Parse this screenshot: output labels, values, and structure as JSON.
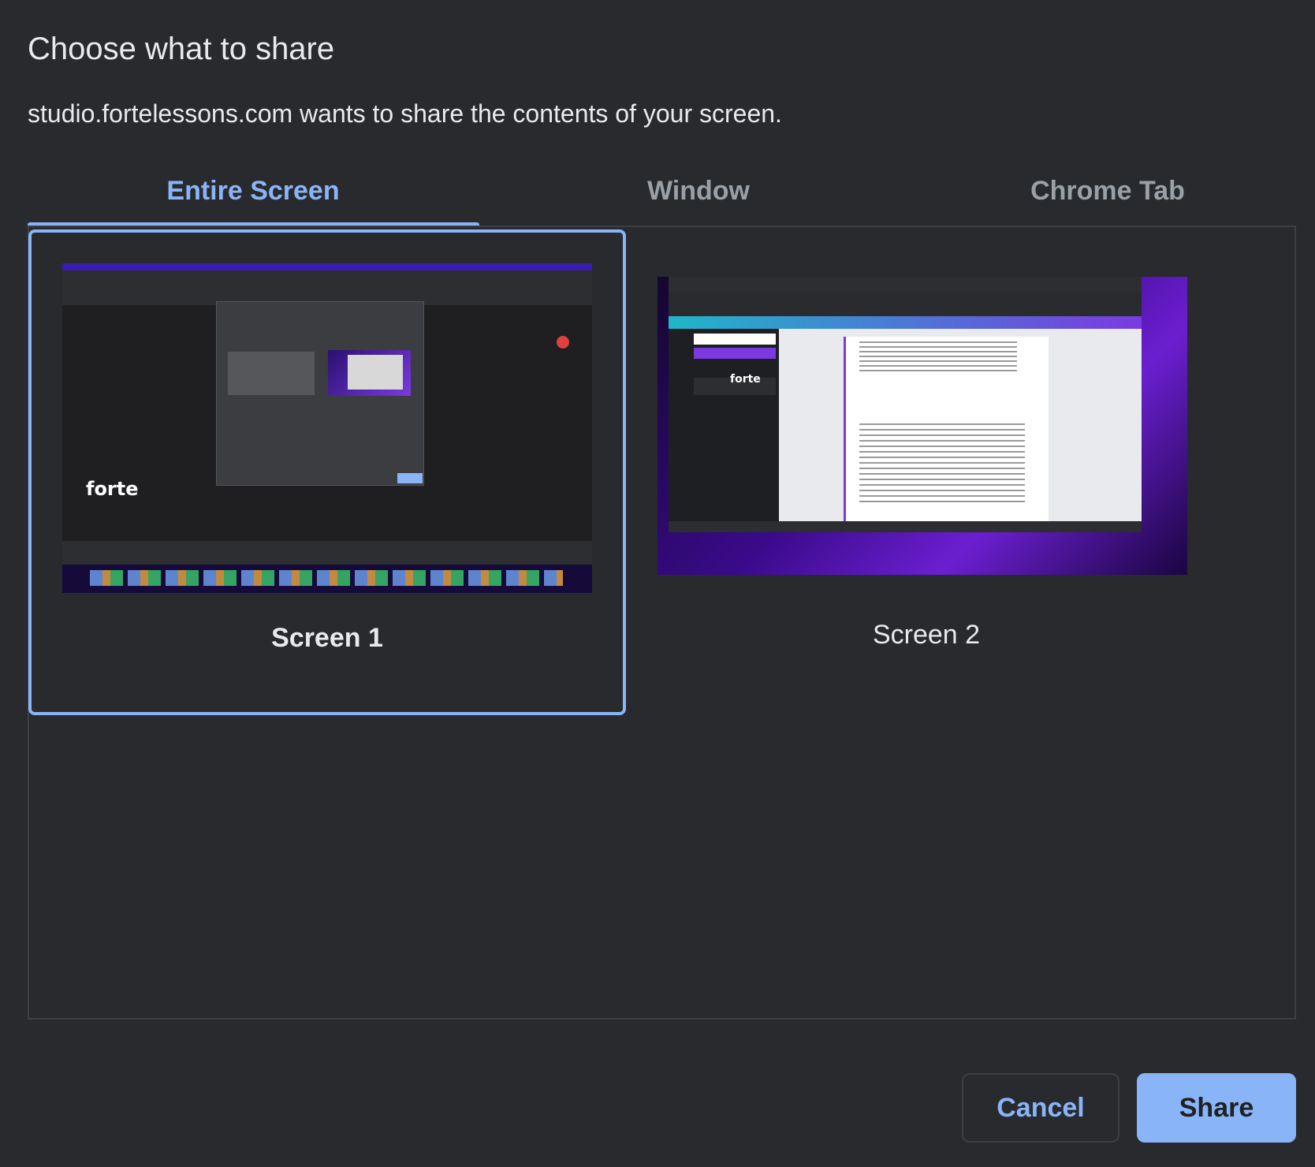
{
  "dialog": {
    "title": "Choose what to share",
    "subtitle": "studio.fortelessons.com wants to share the contents of your screen."
  },
  "tabs": [
    {
      "label": "Entire Screen",
      "selected": true
    },
    {
      "label": "Window",
      "selected": false
    },
    {
      "label": "Chrome Tab",
      "selected": false
    }
  ],
  "sources": [
    {
      "label": "Screen 1",
      "selected": true,
      "thumb_logo": "forte"
    },
    {
      "label": "Screen 2",
      "selected": false,
      "thumb_logo": "forte"
    }
  ],
  "buttons": {
    "cancel": "Cancel",
    "share": "Share"
  },
  "colors": {
    "accent": "#8ab4f8",
    "background": "#292a2d"
  }
}
